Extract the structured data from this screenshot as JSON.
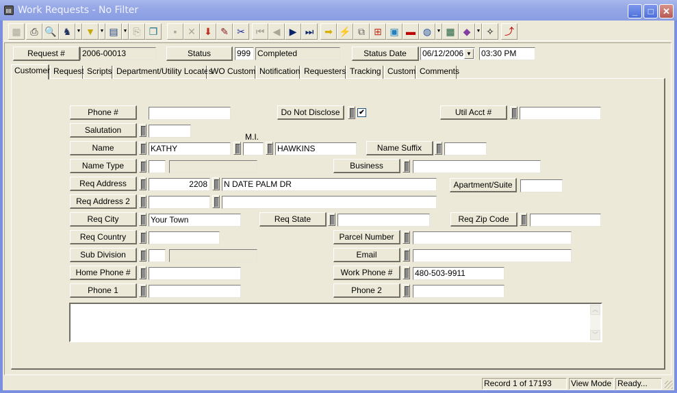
{
  "window": {
    "title": "Work Requests - No Filter",
    "controls": {
      "minimize": "_",
      "maximize": "□",
      "close": "✕"
    }
  },
  "toolbar": {
    "buttons": [
      {
        "icon": "blank-form-icon",
        "glyph": "▦",
        "enabled": false
      },
      {
        "icon": "print-icon",
        "glyph": "⎙",
        "enabled": true
      },
      {
        "icon": "preview-icon",
        "glyph": "🔍",
        "enabled": true
      },
      {
        "icon": "find-icon",
        "glyph": "♞",
        "enabled": true,
        "dropdown": true
      },
      {
        "icon": "filter-icon",
        "glyph": "▼",
        "enabled": true,
        "dropdown": true
      },
      {
        "icon": "report-icon",
        "glyph": "▤",
        "enabled": true,
        "dropdown": true
      },
      {
        "icon": "export-icon",
        "glyph": "⎘",
        "enabled": false
      },
      {
        "icon": "copy-record-icon",
        "glyph": "❐",
        "enabled": true
      },
      {
        "icon": "save-icon",
        "glyph": "▪",
        "enabled": false
      },
      {
        "icon": "delete-icon",
        "glyph": "✕",
        "enabled": false
      },
      {
        "icon": "add-record-icon",
        "glyph": "⬇",
        "enabled": true
      },
      {
        "icon": "edit-icon",
        "glyph": "✎",
        "enabled": true
      },
      {
        "icon": "cut-icon",
        "glyph": "✂",
        "enabled": true
      },
      {
        "icon": "first-record-icon",
        "glyph": "⏮",
        "enabled": false
      },
      {
        "icon": "previous-record-icon",
        "glyph": "◀",
        "enabled": false
      },
      {
        "icon": "next-record-icon",
        "glyph": "▶",
        "enabled": true
      },
      {
        "icon": "last-record-icon",
        "glyph": "⏭",
        "enabled": true
      },
      {
        "icon": "goto-icon",
        "glyph": "➡",
        "enabled": true
      },
      {
        "icon": "lightning-icon",
        "glyph": "⚡",
        "enabled": true
      },
      {
        "icon": "workflow-icon",
        "glyph": "⧉",
        "enabled": true
      },
      {
        "icon": "hierarchy-icon",
        "glyph": "⊞",
        "enabled": true
      },
      {
        "icon": "map-icon",
        "glyph": "▣",
        "enabled": true
      },
      {
        "icon": "toolbox-icon",
        "glyph": "▬",
        "enabled": true
      },
      {
        "icon": "globe-icon",
        "glyph": "◍",
        "enabled": true,
        "dropdown": true
      },
      {
        "icon": "calculator-icon",
        "glyph": "▦",
        "enabled": true
      },
      {
        "icon": "book-icon",
        "glyph": "◆",
        "enabled": true,
        "dropdown": true
      },
      {
        "icon": "new-window-icon",
        "glyph": "✧",
        "enabled": true
      },
      {
        "icon": "exit-icon",
        "glyph": "⤴",
        "enabled": true
      }
    ]
  },
  "header": {
    "request_label": "Request #",
    "request_value": "2006-00013",
    "status_label": "Status",
    "status_code": "999",
    "status_text": "Completed",
    "status_date_label": "Status Date",
    "status_date": "06/12/2006",
    "status_time": "03:30 PM"
  },
  "tabs": [
    {
      "label": "Customer",
      "active": true
    },
    {
      "label": "Request"
    },
    {
      "label": "Scripts"
    },
    {
      "label": "Department/Utility Locates"
    },
    {
      "label": "WO Custom"
    },
    {
      "label": "Notification"
    },
    {
      "label": "Requesters"
    },
    {
      "label": "Tracking"
    },
    {
      "label": "Custom"
    },
    {
      "label": "Comments"
    }
  ],
  "customer": {
    "phone": {
      "label": "Phone #",
      "value": ""
    },
    "do_not_disclose": {
      "label": "Do Not Disclose",
      "checked": true,
      "glyph": "✔"
    },
    "util_acct": {
      "label": "Util Acct #",
      "value": ""
    },
    "salutation": {
      "label": "Salutation",
      "value": ""
    },
    "mi_caption": "M.I.",
    "name": {
      "label": "Name",
      "first": "KATHY",
      "mi": "",
      "last": "HAWKINS"
    },
    "name_suffix": {
      "label": "Name Suffix",
      "value": ""
    },
    "name_type": {
      "label": "Name Type",
      "code": "",
      "desc": ""
    },
    "business": {
      "label": "Business",
      "value": ""
    },
    "req_address": {
      "label": "Req Address",
      "number": "2208",
      "street": "N DATE PALM DR"
    },
    "apartment": {
      "label": "Apartment/Suite",
      "value": ""
    },
    "req_address2": {
      "label": "Req Address 2",
      "number": "",
      "street": ""
    },
    "req_city": {
      "label": "Req City",
      "value": "Your Town"
    },
    "req_state": {
      "label": "Req State",
      "value": ""
    },
    "req_zip": {
      "label": "Req Zip Code",
      "value": ""
    },
    "req_country": {
      "label": "Req Country",
      "value": ""
    },
    "parcel": {
      "label": "Parcel Number",
      "value": ""
    },
    "subdivision": {
      "label": "Sub Division",
      "code": "",
      "desc": ""
    },
    "email": {
      "label": "Email",
      "value": ""
    },
    "home_phone": {
      "label": "Home Phone #",
      "value": ""
    },
    "work_phone": {
      "label": "Work Phone #",
      "value": "480-503-9911"
    },
    "phone1": {
      "label": "Phone 1",
      "value": ""
    },
    "phone2": {
      "label": "Phone 2",
      "value": ""
    },
    "notes": "",
    "scroll_up": "︿",
    "scroll_down": "﹀"
  },
  "statusbar": {
    "record": "Record 1 of 17193",
    "mode": "View Mode",
    "state": "Ready..."
  }
}
